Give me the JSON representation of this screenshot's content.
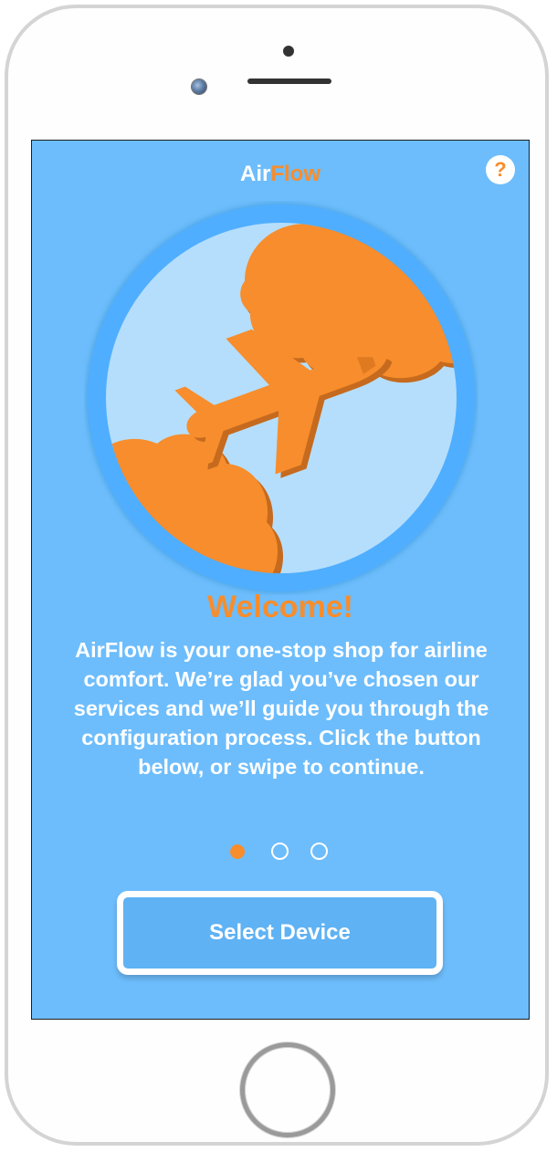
{
  "app": {
    "title_part1": "Air",
    "title_part2": "Flow",
    "help_label": "?"
  },
  "onboarding": {
    "heading": "Welcome!",
    "description": "AirFlow is your one-stop shop for airline comfort. We’re glad you’ve chosen our services and we’ll guide you through the configuration process. Click the button below, or swipe to continue.",
    "page_indicator": {
      "current": 1,
      "total": 3
    },
    "primary_button_label": "Select Device"
  },
  "illustration": {
    "icons": [
      "airplane-icon",
      "cloud-icon"
    ]
  },
  "colors": {
    "screen_background": "#6dbdfc",
    "accent": "#f78d2c",
    "circle_outer": "#4faeff",
    "circle_inner": "#b5defc",
    "text_light": "#ffffff"
  }
}
